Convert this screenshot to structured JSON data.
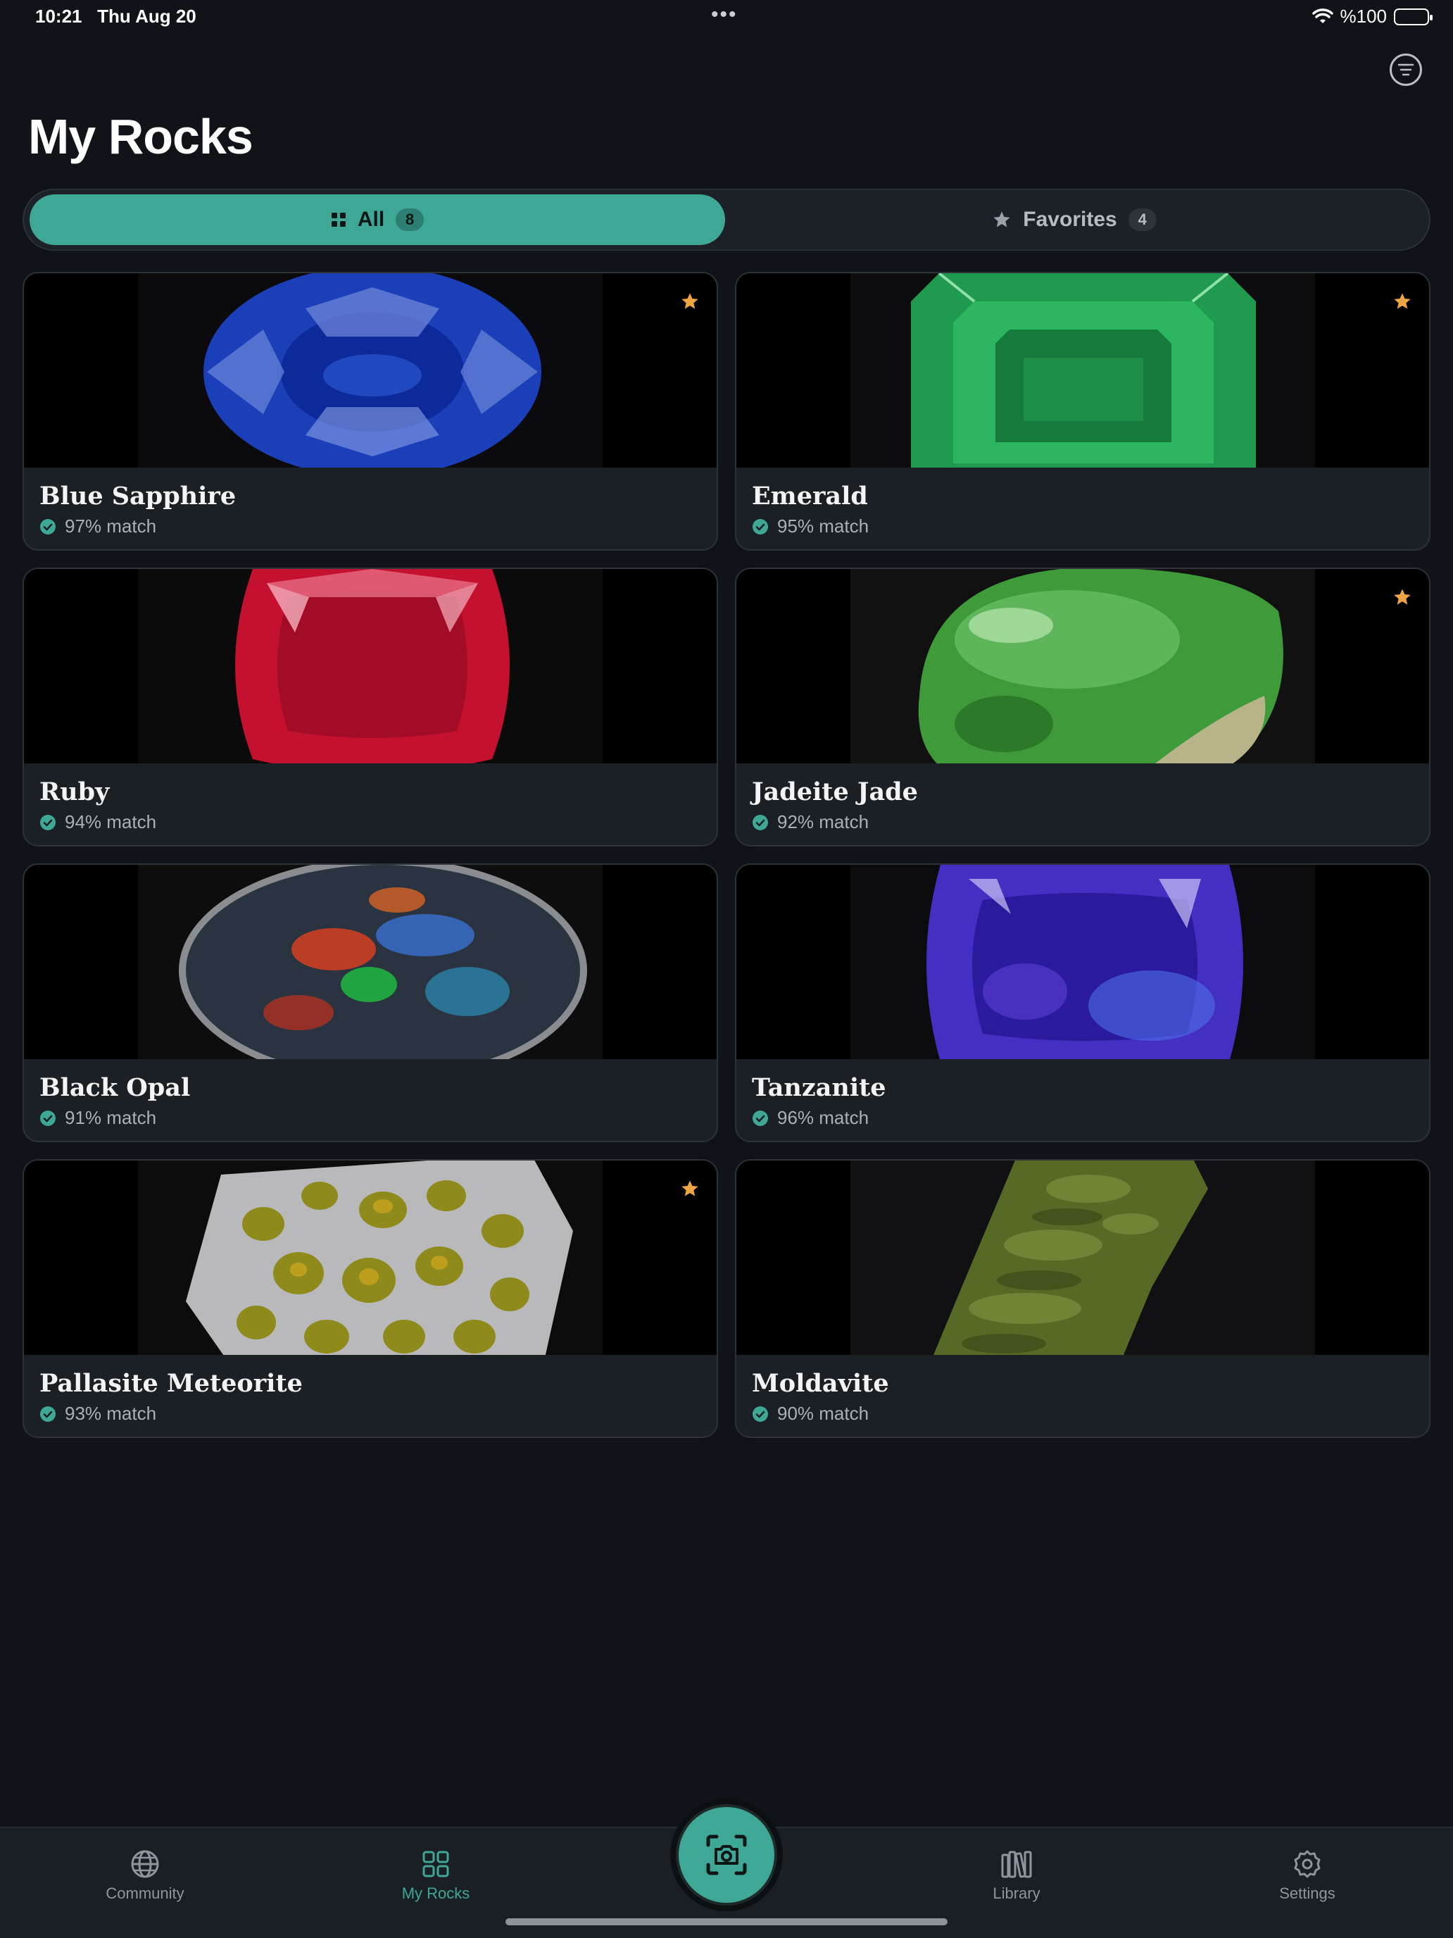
{
  "status_bar": {
    "time": "10:21",
    "date": "Thu Aug 20",
    "dots": "•••",
    "battery": "%100"
  },
  "header": {
    "title": "My Rocks",
    "filter_icon": "filter-lines-icon"
  },
  "tabs": [
    {
      "label": "All",
      "count": "8",
      "icon": "grid-icon",
      "selected": true
    },
    {
      "label": "Favorites",
      "count": "4",
      "icon": "star-icon",
      "selected": false
    }
  ],
  "rocks": [
    {
      "name": "Blue Sapphire",
      "match": "97% match",
      "favorite": true
    },
    {
      "name": "Emerald",
      "match": "95% match",
      "favorite": true
    },
    {
      "name": "Ruby",
      "match": "94% match",
      "favorite": false
    },
    {
      "name": "Jadeite Jade",
      "match": "92% match",
      "favorite": true
    },
    {
      "name": "Black Opal",
      "match": "91% match",
      "favorite": false
    },
    {
      "name": "Tanzanite",
      "match": "96% match",
      "favorite": false
    },
    {
      "name": "Pallasite Meteorite",
      "match": "93% match",
      "favorite": true
    },
    {
      "name": "Moldavite",
      "match": "90% match",
      "favorite": false
    }
  ],
  "bottom_nav": {
    "community": "Community",
    "my_rocks": "My Rocks",
    "library": "Library",
    "settings": "Settings",
    "scan_icon": "camera-scan-icon"
  },
  "colors": {
    "accent": "#3fa796",
    "background": "#101418",
    "card": "#1b2025",
    "star": "#f0a545"
  }
}
